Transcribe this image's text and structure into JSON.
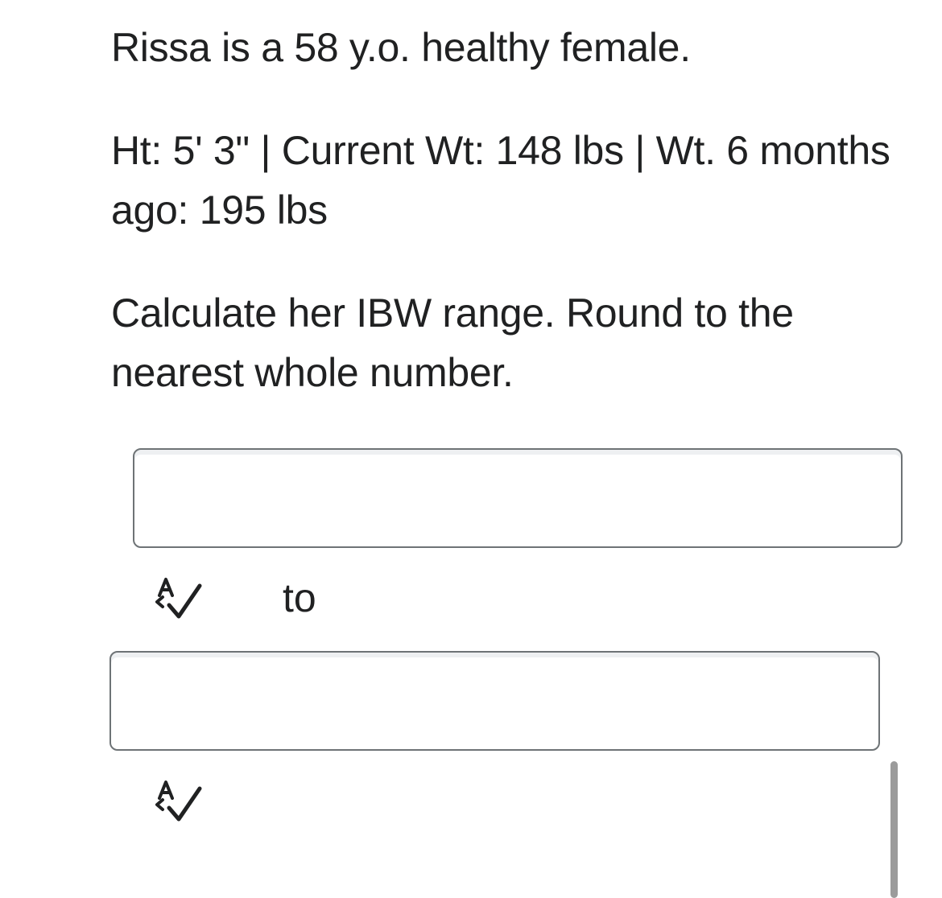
{
  "question": {
    "line1": "Rissa is a 58 y.o. healthy female.",
    "line2": "Ht: 5' 3\" | Current Wt: 148 lbs | Wt. 6 months ago: 195 lbs",
    "line3": "Calculate her IBW range. Round to the nearest whole number."
  },
  "answers": {
    "first_value": "",
    "separator": "to",
    "second_value": ""
  },
  "icons": {
    "spellcheck": "spellcheck-icon",
    "color": "#202122"
  }
}
